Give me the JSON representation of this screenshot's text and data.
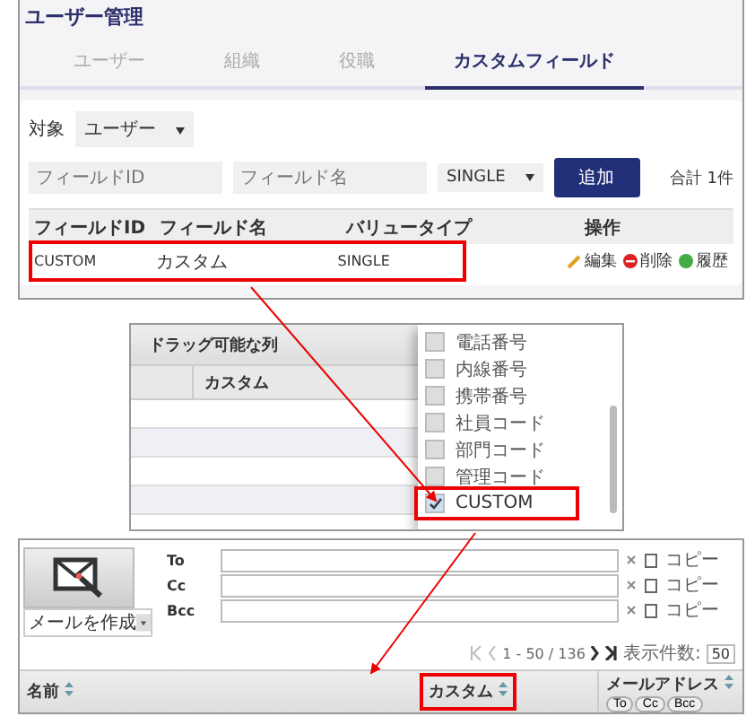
{
  "user_management": {
    "title": "ユーザー管理",
    "tabs": [
      {
        "label": "ユーザー",
        "selected": false
      },
      {
        "label": "組織",
        "selected": false
      },
      {
        "label": "役職",
        "selected": false
      },
      {
        "label": "カスタムフィールド",
        "selected": true
      }
    ],
    "filter": {
      "label": "対象",
      "value": "ユーザー"
    },
    "form": {
      "field_id_placeholder": "フィールドID",
      "field_name_placeholder": "フィールド名",
      "value_type": "SINGLE",
      "add_button": "追加",
      "total": "合計 1件"
    },
    "table": {
      "columns": [
        "フィールドID",
        "フィールド名",
        "バリュータイプ",
        "操作"
      ],
      "rows": [
        {
          "cells": [
            "CUSTOM",
            "カスタム",
            "SINGLE"
          ],
          "actions": [
            "編集",
            "削除",
            "履歴"
          ],
          "highlighted": true
        }
      ]
    }
  },
  "column_picker": {
    "header": "ドラッグ可能な列",
    "columns": [
      "カスタム"
    ],
    "options": [
      {
        "label": "電話番号",
        "checked": false,
        "highlighted": false
      },
      {
        "label": "内線番号",
        "checked": false,
        "highlighted": false
      },
      {
        "label": "携帯番号",
        "checked": false,
        "highlighted": false
      },
      {
        "label": "社員コード",
        "checked": false,
        "highlighted": false
      },
      {
        "label": "部門コード",
        "checked": false,
        "highlighted": false
      },
      {
        "label": "管理コード",
        "checked": false,
        "highlighted": false
      },
      {
        "label": "CUSTOM",
        "checked": true,
        "highlighted": true
      }
    ]
  },
  "mail_list": {
    "compose": "メールを作成",
    "recipients": [
      {
        "label": "To",
        "copy": "コピー"
      },
      {
        "label": "Cc",
        "copy": "コピー"
      },
      {
        "label": "Bcc",
        "copy": "コピー"
      }
    ],
    "pagination": {
      "range": "1 - 50 / 136",
      "per_page_label": "表示件数:",
      "per_page": "50"
    },
    "columns": [
      {
        "label": "名前",
        "highlighted": false
      },
      {
        "label": "カスタム",
        "highlighted": true
      },
      {
        "label": "メールアドレス",
        "highlighted": false,
        "buttons": [
          "To",
          "Cc",
          "Bcc"
        ]
      }
    ]
  }
}
